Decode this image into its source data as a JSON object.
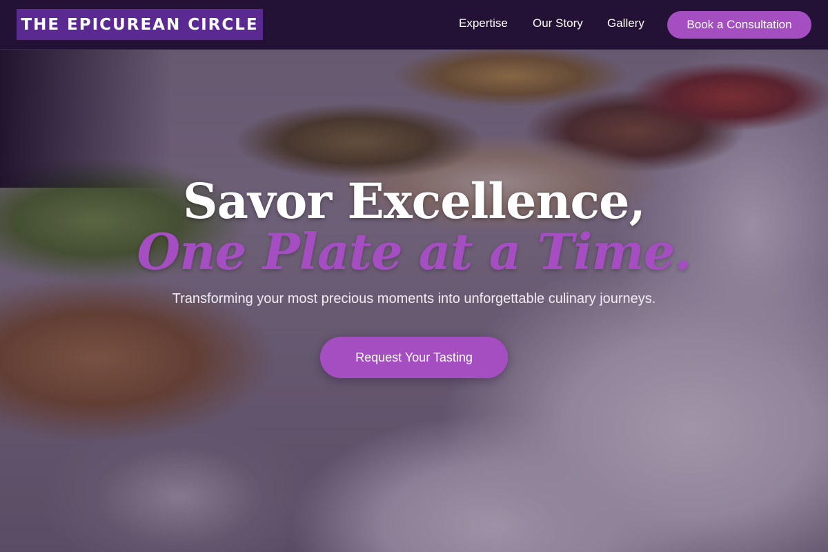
{
  "brand": {
    "name": "THE EPICUREAN CIRCLE"
  },
  "nav": {
    "items": [
      {
        "label": "Expertise"
      },
      {
        "label": "Our Story"
      },
      {
        "label": "Gallery"
      }
    ],
    "cta_label": "Book a Consultation"
  },
  "hero": {
    "title_line1": "Savor Excellence,",
    "title_line2": "One Plate at a Time.",
    "subtitle": "Transforming your most precious moments into unforgettable culinary journeys.",
    "cta_label": "Request Your Tasting",
    "background_image": "buffet-catering-photo"
  },
  "colors": {
    "header_bg": "#241236",
    "brand_bg": "#5a2a92",
    "accent": "#a54ec2",
    "text_light": "#ffffff"
  }
}
